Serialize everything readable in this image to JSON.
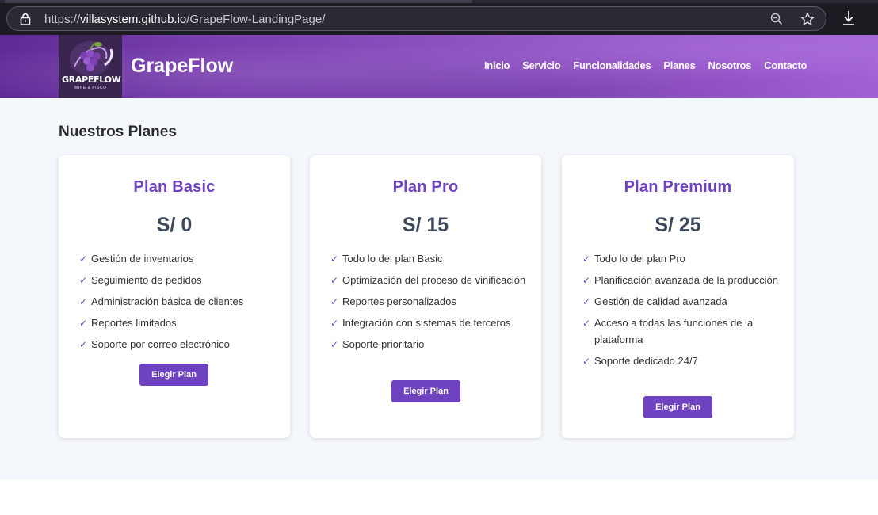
{
  "browser": {
    "url_scheme": "https://",
    "url_host": "villasystem.github.io",
    "url_path": "/GrapeFlow-LandingPage/",
    "icons": [
      "lock-icon",
      "zoom-out-icon",
      "bookmark-star-icon",
      "download-icon"
    ]
  },
  "header": {
    "logo_word": "GRAPEFLOW",
    "logo_sub": "WINE & PISCO",
    "brand": "GrapeFlow",
    "nav": [
      "Inicio",
      "Servicio",
      "Funcionalidades",
      "Planes",
      "Nosotros",
      "Contacto"
    ]
  },
  "section": {
    "title": "Nuestros Planes"
  },
  "plans": [
    {
      "name": "Plan Basic",
      "price": "S/ 0",
      "features": [
        "Gestión de inventarios",
        "Seguimiento de pedidos",
        "Administración básica de clientes",
        "Reportes limitados",
        "Soporte por correo electrónico"
      ],
      "button": "Elegir Plan"
    },
    {
      "name": "Plan Pro",
      "price": "S/ 15",
      "features": [
        "Todo lo del plan Basic",
        "Optimización del proceso de vinificación",
        "Reportes personalizados",
        "Integración con sistemas de terceros",
        "Soporte prioritario"
      ],
      "button": "Elegir Plan"
    },
    {
      "name": "Plan Premium",
      "price": "S/ 25",
      "features": [
        "Todo lo del plan Pro",
        "Planificación avanzada de la producción",
        "Gestión de calidad avanzada",
        "Acceso a todas las funciones de la plataforma",
        "Soporte dedicado 24/7"
      ],
      "button": "Elegir Plan"
    }
  ],
  "colors": {
    "accent": "#6f42c1",
    "price": "#3d4a5c",
    "section_bg": "#f4f7fb"
  },
  "check_glyph": "✓"
}
